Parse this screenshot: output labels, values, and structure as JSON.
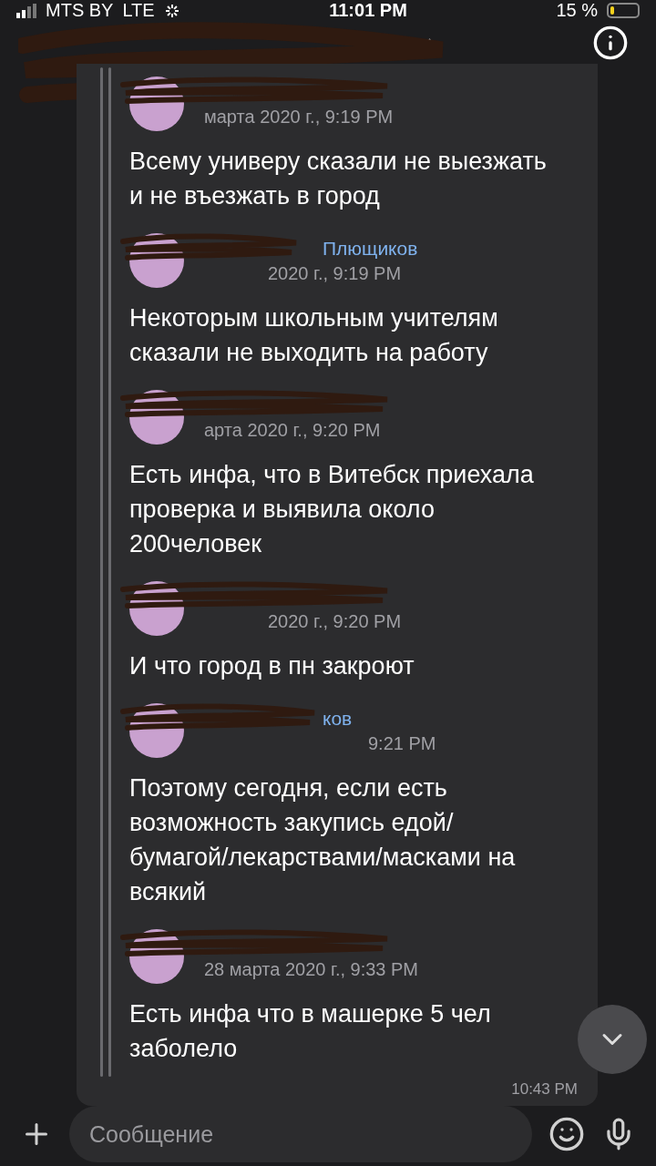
{
  "status_bar": {
    "carrier": "MTS BY",
    "network": "LTE",
    "time": "11:01 PM",
    "battery": "15 %"
  },
  "messages": [
    {
      "date": "марта 2020 г., 9:19 PM",
      "text": "Всему универу сказали не выезжать и не въезжать в город"
    },
    {
      "author": "Плющиков",
      "date": "2020 г., 9:19 PM",
      "text": "Некоторым школьным учителям сказали не выходить на работу"
    },
    {
      "date": "арта 2020 г., 9:20 PM",
      "text": "Есть инфа, что в Витебск приехала проверка и выявила около 200человек"
    },
    {
      "date": "2020 г., 9:20 PM",
      "text": "И что город в пн закроют"
    },
    {
      "author": "ков",
      "date": "9:21 PM",
      "text": "Поэтому сегодня, если есть возможность закупись едой/бумагой/лекарствами/масками на всякий"
    },
    {
      "date": "28 марта 2020 г., 9:33 PM",
      "text": "Есть инфа что в машерке 5 чел заболело"
    }
  ],
  "bubble_time": "10:43 PM",
  "composer": {
    "placeholder": "Сообщение"
  }
}
